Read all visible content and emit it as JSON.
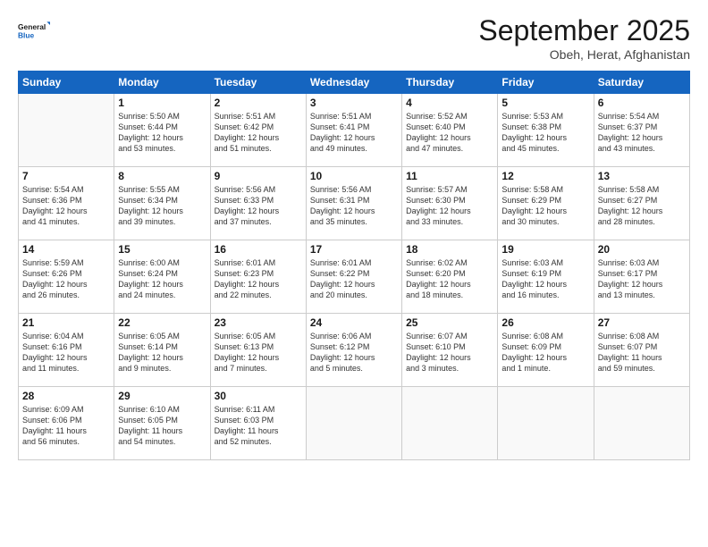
{
  "logo": {
    "line1": "General",
    "line2": "Blue"
  },
  "title": "September 2025",
  "subtitle": "Obeh, Herat, Afghanistan",
  "days_header": [
    "Sunday",
    "Monday",
    "Tuesday",
    "Wednesday",
    "Thursday",
    "Friday",
    "Saturday"
  ],
  "weeks": [
    [
      {
        "day": "",
        "info": ""
      },
      {
        "day": "1",
        "info": "Sunrise: 5:50 AM\nSunset: 6:44 PM\nDaylight: 12 hours\nand 53 minutes."
      },
      {
        "day": "2",
        "info": "Sunrise: 5:51 AM\nSunset: 6:42 PM\nDaylight: 12 hours\nand 51 minutes."
      },
      {
        "day": "3",
        "info": "Sunrise: 5:51 AM\nSunset: 6:41 PM\nDaylight: 12 hours\nand 49 minutes."
      },
      {
        "day": "4",
        "info": "Sunrise: 5:52 AM\nSunset: 6:40 PM\nDaylight: 12 hours\nand 47 minutes."
      },
      {
        "day": "5",
        "info": "Sunrise: 5:53 AM\nSunset: 6:38 PM\nDaylight: 12 hours\nand 45 minutes."
      },
      {
        "day": "6",
        "info": "Sunrise: 5:54 AM\nSunset: 6:37 PM\nDaylight: 12 hours\nand 43 minutes."
      }
    ],
    [
      {
        "day": "7",
        "info": "Sunrise: 5:54 AM\nSunset: 6:36 PM\nDaylight: 12 hours\nand 41 minutes."
      },
      {
        "day": "8",
        "info": "Sunrise: 5:55 AM\nSunset: 6:34 PM\nDaylight: 12 hours\nand 39 minutes."
      },
      {
        "day": "9",
        "info": "Sunrise: 5:56 AM\nSunset: 6:33 PM\nDaylight: 12 hours\nand 37 minutes."
      },
      {
        "day": "10",
        "info": "Sunrise: 5:56 AM\nSunset: 6:31 PM\nDaylight: 12 hours\nand 35 minutes."
      },
      {
        "day": "11",
        "info": "Sunrise: 5:57 AM\nSunset: 6:30 PM\nDaylight: 12 hours\nand 33 minutes."
      },
      {
        "day": "12",
        "info": "Sunrise: 5:58 AM\nSunset: 6:29 PM\nDaylight: 12 hours\nand 30 minutes."
      },
      {
        "day": "13",
        "info": "Sunrise: 5:58 AM\nSunset: 6:27 PM\nDaylight: 12 hours\nand 28 minutes."
      }
    ],
    [
      {
        "day": "14",
        "info": "Sunrise: 5:59 AM\nSunset: 6:26 PM\nDaylight: 12 hours\nand 26 minutes."
      },
      {
        "day": "15",
        "info": "Sunrise: 6:00 AM\nSunset: 6:24 PM\nDaylight: 12 hours\nand 24 minutes."
      },
      {
        "day": "16",
        "info": "Sunrise: 6:01 AM\nSunset: 6:23 PM\nDaylight: 12 hours\nand 22 minutes."
      },
      {
        "day": "17",
        "info": "Sunrise: 6:01 AM\nSunset: 6:22 PM\nDaylight: 12 hours\nand 20 minutes."
      },
      {
        "day": "18",
        "info": "Sunrise: 6:02 AM\nSunset: 6:20 PM\nDaylight: 12 hours\nand 18 minutes."
      },
      {
        "day": "19",
        "info": "Sunrise: 6:03 AM\nSunset: 6:19 PM\nDaylight: 12 hours\nand 16 minutes."
      },
      {
        "day": "20",
        "info": "Sunrise: 6:03 AM\nSunset: 6:17 PM\nDaylight: 12 hours\nand 13 minutes."
      }
    ],
    [
      {
        "day": "21",
        "info": "Sunrise: 6:04 AM\nSunset: 6:16 PM\nDaylight: 12 hours\nand 11 minutes."
      },
      {
        "day": "22",
        "info": "Sunrise: 6:05 AM\nSunset: 6:14 PM\nDaylight: 12 hours\nand 9 minutes."
      },
      {
        "day": "23",
        "info": "Sunrise: 6:05 AM\nSunset: 6:13 PM\nDaylight: 12 hours\nand 7 minutes."
      },
      {
        "day": "24",
        "info": "Sunrise: 6:06 AM\nSunset: 6:12 PM\nDaylight: 12 hours\nand 5 minutes."
      },
      {
        "day": "25",
        "info": "Sunrise: 6:07 AM\nSunset: 6:10 PM\nDaylight: 12 hours\nand 3 minutes."
      },
      {
        "day": "26",
        "info": "Sunrise: 6:08 AM\nSunset: 6:09 PM\nDaylight: 12 hours\nand 1 minute."
      },
      {
        "day": "27",
        "info": "Sunrise: 6:08 AM\nSunset: 6:07 PM\nDaylight: 11 hours\nand 59 minutes."
      }
    ],
    [
      {
        "day": "28",
        "info": "Sunrise: 6:09 AM\nSunset: 6:06 PM\nDaylight: 11 hours\nand 56 minutes."
      },
      {
        "day": "29",
        "info": "Sunrise: 6:10 AM\nSunset: 6:05 PM\nDaylight: 11 hours\nand 54 minutes."
      },
      {
        "day": "30",
        "info": "Sunrise: 6:11 AM\nSunset: 6:03 PM\nDaylight: 11 hours\nand 52 minutes."
      },
      {
        "day": "",
        "info": ""
      },
      {
        "day": "",
        "info": ""
      },
      {
        "day": "",
        "info": ""
      },
      {
        "day": "",
        "info": ""
      }
    ]
  ]
}
